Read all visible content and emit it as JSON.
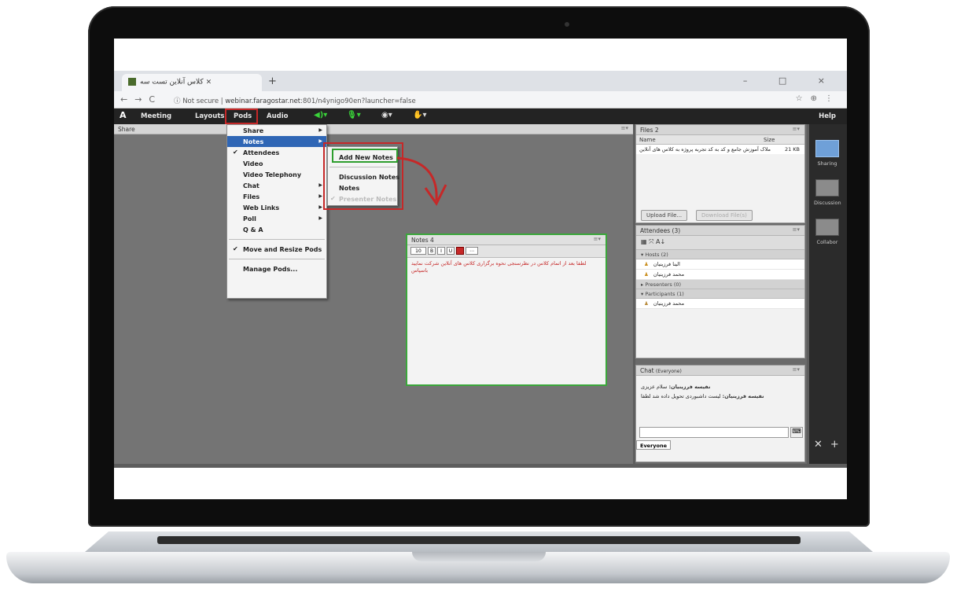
{
  "browser": {
    "tab_title": "کلاس آنلاین تست سه ×",
    "new_tab": "+",
    "url_prefix": "Not secure",
    "url_host": "webinar.faragostar.net",
    "url_path": ":801/n4ynigo90en?launcher=false",
    "window_buttons": "– □ ×"
  },
  "menubar": {
    "meeting": "Meeting",
    "layouts": "Layouts",
    "pods": "Pods",
    "audio": "Audio",
    "help": "Help"
  },
  "share_pod": {
    "title": "Share"
  },
  "pods_menu": {
    "items": [
      "Share",
      "Notes",
      "Attendees",
      "Video",
      "Video Telephony",
      "Chat",
      "Files",
      "Web Links",
      "Poll",
      "Q & A"
    ],
    "move_resize": "Move and Resize Pods",
    "manage": "Manage Pods..."
  },
  "notes_submenu": {
    "add_new": "Add New Notes",
    "discussion": "Discussion Notes",
    "notes": "Notes",
    "presenter": "Presenter Notes"
  },
  "notes_pod": {
    "title": "Notes 4",
    "font_size": "10",
    "text": "لطفا بعد از اتمام کلاس در نظرسنجی نحوه برگزاری کلاس های آنلاین شرکت نمایید باسپاس"
  },
  "files_pod": {
    "title": "Files 2",
    "col_name": "Name",
    "col_size": "Size",
    "file_name": "ملاک آموزش جامع و کد به کد تجربه پروژه به کلاس های آنلاین",
    "file_size": "21 KB",
    "upload": "Upload File...",
    "download": "Download File(s)"
  },
  "attendees_pod": {
    "title": "Attendees",
    "count": "(3)",
    "hosts": "Hosts (2)",
    "host1": "الینا فرزینیان",
    "host2": "محمد فرزینیان",
    "presenters": "Presenters (0)",
    "participants": "Participants (1)",
    "participant1": "محمد فرزینیان"
  },
  "chat_pod": {
    "title": "Chat",
    "scope": "(Everyone)",
    "msg1_user": "نفیسه فرزینیان:",
    "msg1_text": "سلام عزیزی",
    "msg2_user": "نفیسه فرزینیان:",
    "msg2_text": "لیست داشبوردی تحویل داده شد لطفا",
    "send": "⌨",
    "everyone_tab": "Everyone"
  },
  "layout_bar": {
    "sharing": "Sharing",
    "discussion": "Discussion",
    "collabor": "Collabor"
  }
}
